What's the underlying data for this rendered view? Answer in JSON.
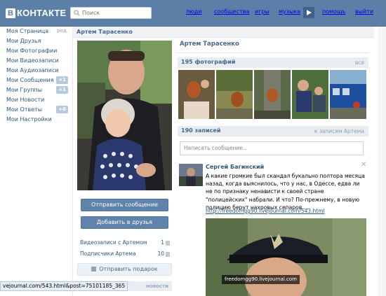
{
  "header": {
    "logo_mark": "В",
    "logo_text": "КОНТАКТЕ",
    "search_placeholder": "Поиск",
    "nav": [
      {
        "label": "люди",
        "name": "nav-people"
      },
      {
        "label": "сообщества",
        "name": "nav-communities"
      },
      {
        "label": "игры",
        "name": "nav-games"
      },
      {
        "label": "музыка",
        "name": "nav-music"
      },
      {
        "label": "помощь",
        "name": "nav-help"
      },
      {
        "label": "выйти",
        "name": "nav-logout"
      }
    ]
  },
  "sidebar": {
    "edit_label": "ред.",
    "items": [
      {
        "label": "Моя Страница",
        "badge": ""
      },
      {
        "label": "Мои Друзья",
        "badge": ""
      },
      {
        "label": "Мои Фотографии",
        "badge": ""
      },
      {
        "label": "Мои Видеозаписи",
        "badge": ""
      },
      {
        "label": "Мои Аудиозаписи",
        "badge": ""
      },
      {
        "label": "Мои Сообщения",
        "badge": "+1"
      },
      {
        "label": "Мои Группы",
        "badge": "+1"
      },
      {
        "label": "Мои Новости",
        "badge": ""
      },
      {
        "label": "Мои Ответы",
        "badge": "+6"
      },
      {
        "label": "Мои Настройки",
        "badge": ""
      }
    ]
  },
  "profile": {
    "header_name": "Артем Тарасенко",
    "name": "Артем Тарасенко",
    "send_message": "Отправить сообщение",
    "add_friend": "Добавить в друзья",
    "videos_label": "Видеозаписи с Артемом",
    "videos_count": "1",
    "subscribers_label": "Подписчики Артема",
    "subscribers_count": "10",
    "gift_label": "Отправить подарок",
    "news_label": "новости"
  },
  "photos_section": {
    "title": "195 фотографий",
    "link": "все"
  },
  "wall_section": {
    "title": "190 записей",
    "link": "к записям Артема",
    "input_placeholder": "Написать сообщение.."
  },
  "post": {
    "author": "Сергей Багинский",
    "close": "✕",
    "text": "А какие громкие был скандал букально полтора месяца назад, когда выяснилось, что у нас, в Одессе, едва ли не по признаку ненависти к своей стране \"полицейских\" набрали. И что? По-прежнему, в новую полицию берут нахровых сепаров....",
    "link": "http://freedomgg90.livejournal.com/543.html",
    "image_caption": "freedomgg90.livejournal.com"
  },
  "statusbar": {
    "text": "vejournal.com/543.html&post=75101185_365"
  },
  "colors": {
    "header_bg": "#5b7fa6",
    "link": "#2b587a",
    "accent": "#45688e",
    "button": "#5f83aa"
  }
}
